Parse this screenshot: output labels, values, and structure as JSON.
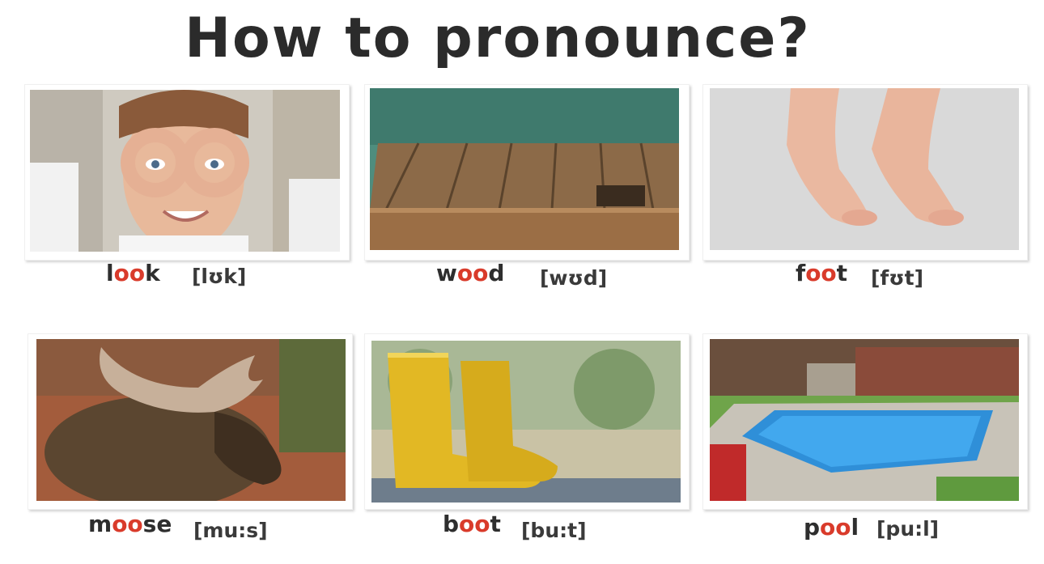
{
  "title": "How to pronounce?",
  "highlight_color": "#d93b2b",
  "items": [
    {
      "pre": "l",
      "oo": "oo",
      "post": "k",
      "ipa": "[lʊk]",
      "image": "woman-looking-through-hand-binoculars"
    },
    {
      "pre": "w",
      "oo": "oo",
      "post": "d",
      "ipa": "[wʊd]",
      "image": "wooden-planks"
    },
    {
      "pre": "f",
      "oo": "oo",
      "post": "t",
      "ipa": "[fʊt]",
      "image": "bare-feet-on-tiptoe"
    },
    {
      "pre": "m",
      "oo": "oo",
      "post": "se",
      "ipa": "[mu:s]",
      "image": "moose"
    },
    {
      "pre": "b",
      "oo": "oo",
      "post": "t",
      "ipa": "[bu:t]",
      "image": "yellow-rain-boots"
    },
    {
      "pre": "p",
      "oo": "oo",
      "post": "l",
      "ipa": "[pu:l]",
      "image": "swimming-pool"
    }
  ]
}
